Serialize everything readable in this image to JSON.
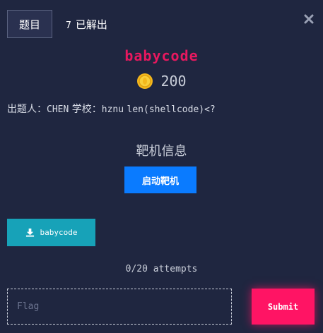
{
  "header": {
    "tab_label": "题目",
    "solved_count": "7",
    "solved_label": "已解出"
  },
  "challenge": {
    "name": "babycode",
    "points": "200",
    "author_prefix": "出题人：",
    "author_name": "CHEN",
    "school_prefix": "学校：",
    "school_name": "hznu",
    "hint": "len(shellcode)<?"
  },
  "target": {
    "heading": "靶机信息",
    "start_label": "启动靶机"
  },
  "download": {
    "label": "babycode"
  },
  "attempts": "0/20 attempts",
  "flag": {
    "placeholder": "Flag",
    "value": "",
    "submit_label": "Submit"
  },
  "colors": {
    "background": "#1f2640",
    "title": "#e8185f",
    "start_button": "#0a7bff",
    "download_button": "#17a2b8",
    "submit_button": "#ff1464"
  },
  "icons": {
    "close": "close-icon",
    "coin": "coin-icon",
    "download": "download-icon"
  }
}
